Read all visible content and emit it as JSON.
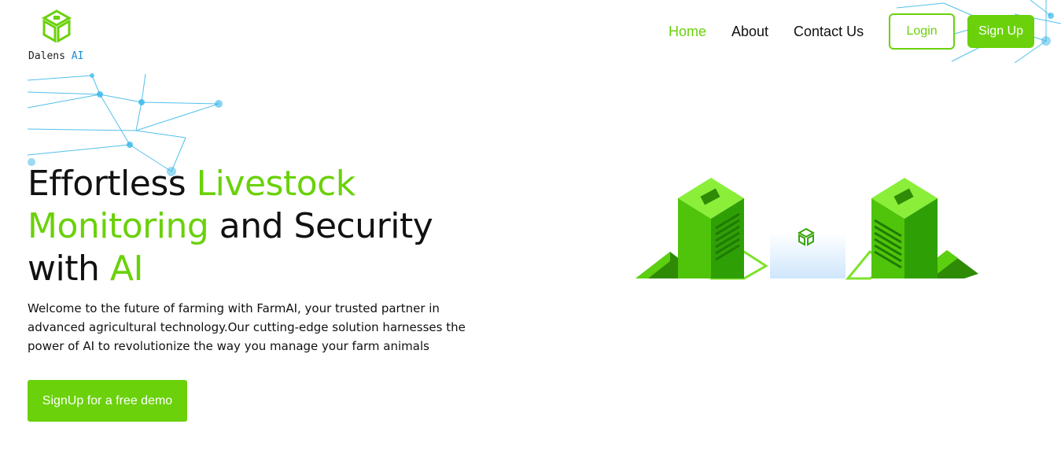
{
  "brand": {
    "name": "Dalens",
    "suffix": "AI"
  },
  "nav": {
    "items": [
      {
        "label": "Home",
        "active": true
      },
      {
        "label": "About",
        "active": false
      },
      {
        "label": "Contact Us",
        "active": false
      }
    ],
    "login_label": "Login",
    "signup_label": "Sign Up"
  },
  "hero": {
    "title": {
      "part1": "Effortless ",
      "part2": "Livestock Monitoring",
      "part3": " and Security with ",
      "part4": "AI"
    },
    "description": "Welcome to the future of farming with FarmAI, your trusted partner in advanced agricultural technology.Our cutting-edge solution harnesses the power of AI to revolutionize the way you manage your farm animals",
    "cta_label": "SignUp for a free demo"
  },
  "colors": {
    "accent": "#6ad10a",
    "network": "#35b6e8",
    "brand_ai": "#1a8bd4"
  },
  "icons": [
    "dalens-logo-icon",
    "server-illustration-icon",
    "network-lines-icon"
  ]
}
